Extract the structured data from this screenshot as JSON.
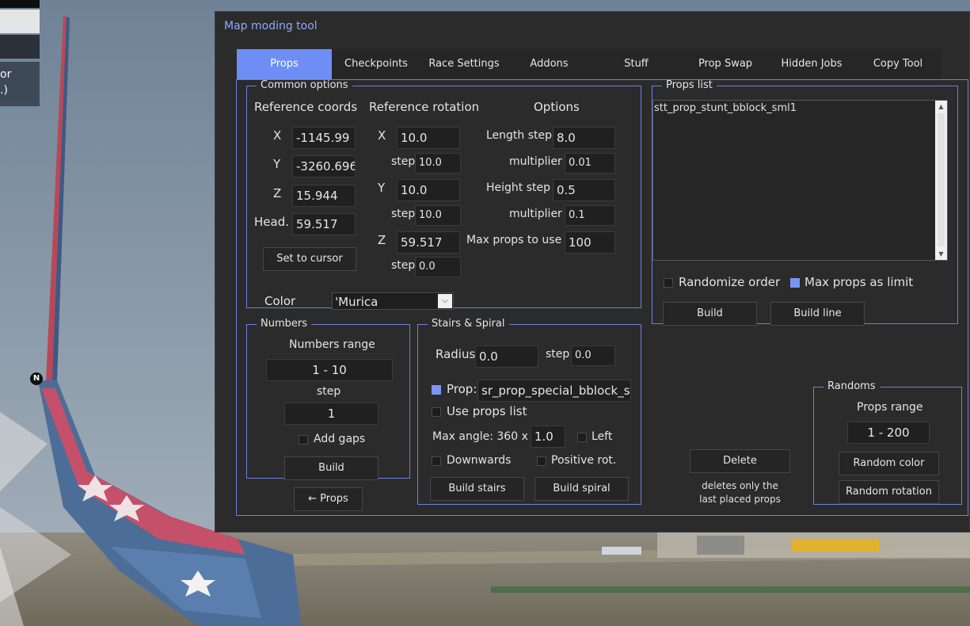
{
  "hud": {
    "panel_lines": [
      "or",
      ".)"
    ],
    "north": "N"
  },
  "window": {
    "title": "Map moding tool"
  },
  "tabs": [
    {
      "label": "Props",
      "active": true
    },
    {
      "label": "Checkpoints"
    },
    {
      "label": "Race Settings"
    },
    {
      "label": "Addons"
    },
    {
      "label": "Stuff"
    },
    {
      "label": "Prop Swap"
    },
    {
      "label": "Hidden Jobs"
    },
    {
      "label": "Copy Tool"
    }
  ],
  "common": {
    "legend": "Common options",
    "ref_coords_header": "Reference coords",
    "ref_rotation_header": "Reference rotation",
    "options_header": "Options",
    "coords": {
      "x_label": "X",
      "x": "-1145.99",
      "y_label": "Y",
      "y": "-3260.696",
      "z_label": "Z",
      "z": "15.944",
      "head_label": "Head.",
      "head": "59.517"
    },
    "set_cursor": "Set to cursor",
    "rotation": {
      "x_label": "X",
      "x": "10.0",
      "y_label": "Y",
      "y": "10.0",
      "z_label": "Z",
      "z": "59.517",
      "step_label": "step",
      "x_step": "10.0",
      "y_step": "10.0",
      "z_step": "0.0"
    },
    "options": {
      "length_step_label": "Length step",
      "length_step": "8.0",
      "length_mult_label": "multiplier",
      "length_mult": "0.01",
      "height_step_label": "Height step",
      "height_step": "0.5",
      "height_mult_label": "multiplier",
      "height_mult": "0.1",
      "max_props_label": "Max props to use",
      "max_props": "100"
    },
    "color_label": "Color",
    "color_value": "'Murica"
  },
  "props_list": {
    "legend": "Props list",
    "items": [
      "stt_prop_stunt_bblock_sml1"
    ],
    "randomize_label": "Randomize order",
    "randomize_checked": false,
    "max_limit_label": "Max props as limit",
    "max_limit_checked": true,
    "build": "Build",
    "build_line": "Build line"
  },
  "numbers": {
    "legend": "Numbers",
    "range_label": "Numbers range",
    "range": "1  -  10",
    "step_label": "step",
    "step": "1",
    "gaps_label": "Add gaps",
    "gaps_checked": false,
    "build": "Build"
  },
  "back_props": "← Props",
  "stairs": {
    "legend": "Stairs & Spiral",
    "radius_label": "Radius",
    "radius": "0.0",
    "step_label": "step",
    "step": "0.0",
    "prop_label": "Prop:",
    "prop_checked": true,
    "prop": "sr_prop_special_bblock_sr",
    "use_list_label": "Use props list",
    "use_list_checked": false,
    "max_angle_label": "Max angle: 360 x",
    "max_angle": "1.0",
    "left_label": "Left",
    "left_checked": false,
    "down_label": "Downwards",
    "down_checked": false,
    "positive_label": "Positive rot.",
    "positive_checked": false,
    "build_stairs": "Build stairs",
    "build_spiral": "Build spiral"
  },
  "delete": {
    "label": "Delete",
    "note_line1": "deletes only the",
    "note_line2": "last placed props"
  },
  "randoms": {
    "legend": "Randoms",
    "range_label": "Props range",
    "range": "1  -  200",
    "color_btn": "Random color",
    "rotation_btn": "Random rotation"
  },
  "colors": {
    "accent": "#6e8ef5",
    "panel": "#2b2b2b",
    "border": "#6e7fe0",
    "title": "#8fa8ff"
  }
}
